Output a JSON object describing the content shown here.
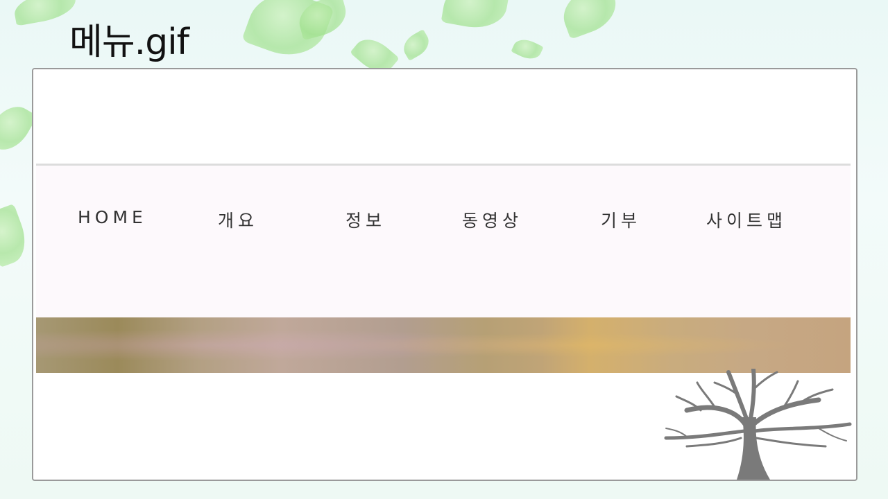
{
  "slide": {
    "title": "메뉴.gif"
  },
  "menu": {
    "items": [
      {
        "label": "HOME"
      },
      {
        "label": "개요"
      },
      {
        "label": "정보"
      },
      {
        "label": "동영상"
      },
      {
        "label": "기부"
      },
      {
        "label": "사이트맵"
      }
    ]
  },
  "colors": {
    "menu_text": "#333333",
    "menu_bar_bg": "#fdf9fc",
    "frame_border": "#9a9a9a",
    "tree": "#7a7a7a"
  }
}
